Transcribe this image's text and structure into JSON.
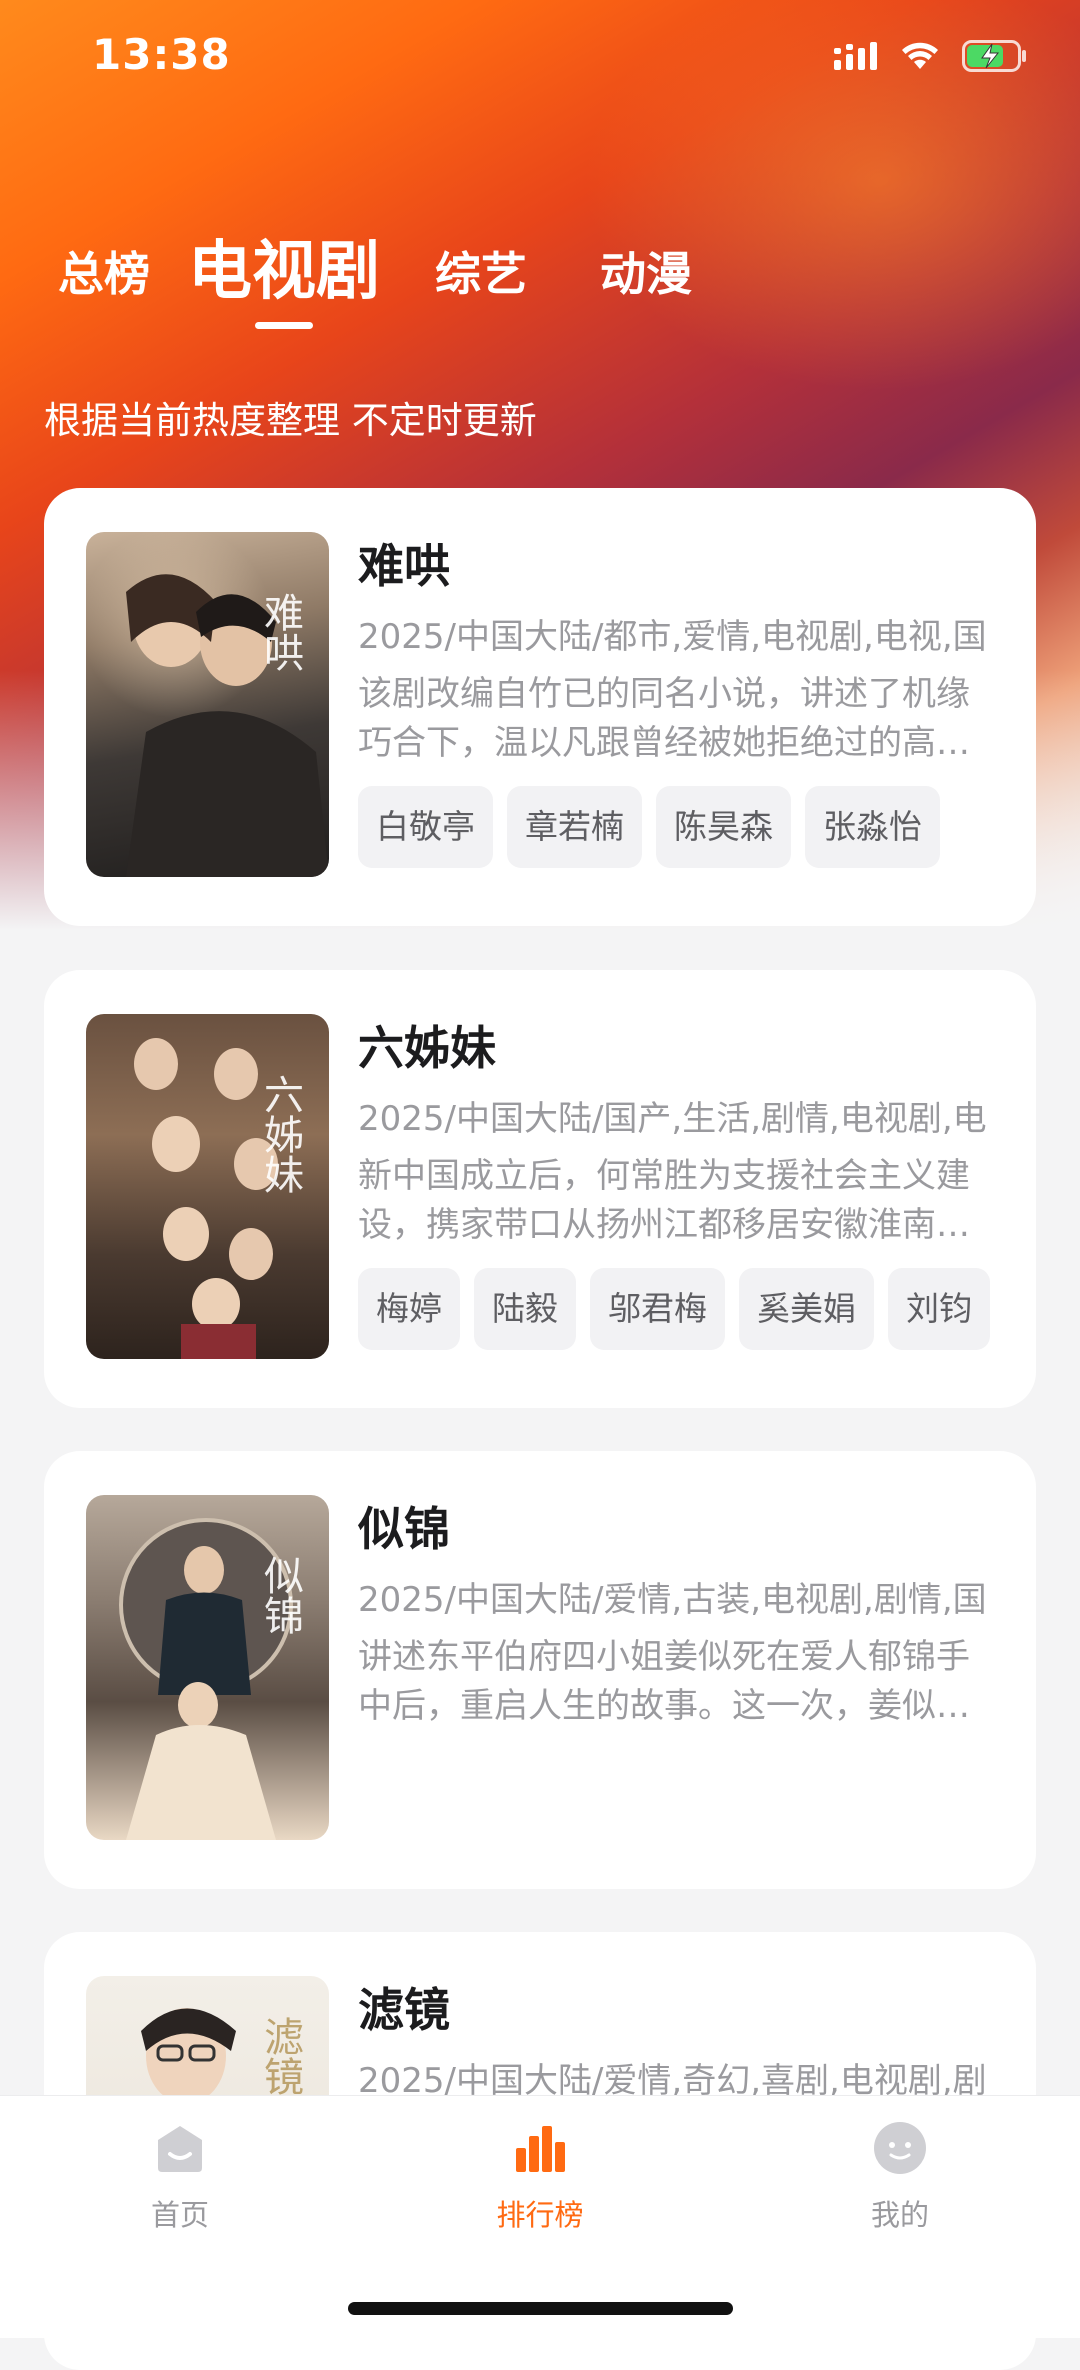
{
  "status_bar": {
    "time": "13:38"
  },
  "tabs": [
    {
      "label": "总榜"
    },
    {
      "label": "电视剧"
    },
    {
      "label": "综艺"
    },
    {
      "label": "动漫"
    }
  ],
  "active_tab": "电视剧",
  "subtitle": "根据当前热度整理 不定时更新",
  "items": [
    {
      "title": "难哄",
      "poster_text": "难哄",
      "meta": "2025/中国大陆/都市,爱情,电视剧,电视,国",
      "desc": "该剧改编自竹已的同名小说，讲述了机缘巧合下，温以凡跟曾经被她拒绝过的高…",
      "cast": [
        "白敬亭",
        "章若楠",
        "陈昊森",
        "张淼怡"
      ]
    },
    {
      "title": "六姊妹",
      "poster_text": "六姊妹",
      "meta": "2025/中国大陆/国产,生活,剧情,电视剧,电",
      "desc": "新中国成立后，何常胜为支援社会主义建设，携家带口从扬州江都移居安徽淮南…",
      "cast": [
        "梅婷",
        "陆毅",
        "邬君梅",
        "奚美娟",
        "刘钧"
      ]
    },
    {
      "title": "似锦",
      "poster_text": "似锦",
      "meta": "2025/中国大陆/爱情,古装,电视剧,剧情,国",
      "desc": "讲述东平伯府四小姐姜似死在爱人郁锦手中后，重启人生的故事。这一次，姜似…",
      "cast": []
    },
    {
      "title": "滤镜",
      "poster_text": "滤镜",
      "meta": "2025/中国大陆/爱情,奇幻,喜剧,电视剧,剧",
      "desc": "",
      "cast": []
    }
  ],
  "bottom_nav": [
    {
      "label": "首页",
      "icon": "home-icon"
    },
    {
      "label": "排行榜",
      "icon": "ranking-bar-chart-icon"
    },
    {
      "label": "我的",
      "icon": "profile-smile-icon"
    }
  ],
  "colors": {
    "accent": "#ff6a12",
    "muted": "#9a9a9e"
  }
}
